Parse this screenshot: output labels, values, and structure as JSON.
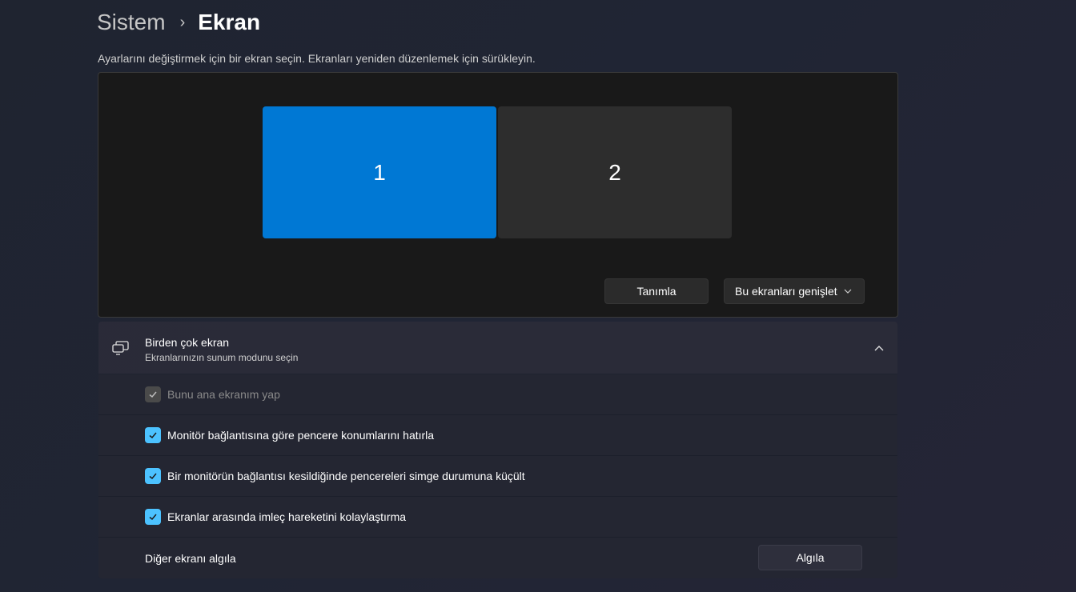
{
  "breadcrumb": {
    "parent": "Sistem",
    "separator": "›",
    "current": "Ekran"
  },
  "instruction": "Ayarlarını değiştirmek için bir ekran seçin. Ekranları yeniden düzenlemek için sürükleyin.",
  "monitors": [
    {
      "label": "1",
      "selected": true,
      "color": "#0078d4"
    },
    {
      "label": "2",
      "selected": false,
      "color": "#2d2d2d"
    }
  ],
  "buttons": {
    "identify": "Tanımla",
    "extend_select": "Bu ekranları genişlet"
  },
  "multiple_displays": {
    "title": "Birden çok ekran",
    "subtitle": "Ekranlarınızın sunum modunu seçin",
    "icon": "multi-monitor-icon",
    "expanded": true,
    "options": [
      {
        "label": "Bunu ana ekranım yap",
        "checked": true,
        "disabled": true
      },
      {
        "label": "Monitör bağlantısına göre pencere konumlarını hatırla",
        "checked": true,
        "disabled": false
      },
      {
        "label": "Bir monitörün bağlantısı kesildiğinde pencereleri simge durumuna küçült",
        "checked": true,
        "disabled": false
      },
      {
        "label": "Ekranlar arasında imleç hareketini kolaylaştırma",
        "checked": true,
        "disabled": false
      }
    ],
    "detect": {
      "label": "Diğer ekranı algıla",
      "button": "Algıla"
    }
  },
  "colors": {
    "accent": "#0078d4",
    "checkbox": "#4cc2ff"
  }
}
